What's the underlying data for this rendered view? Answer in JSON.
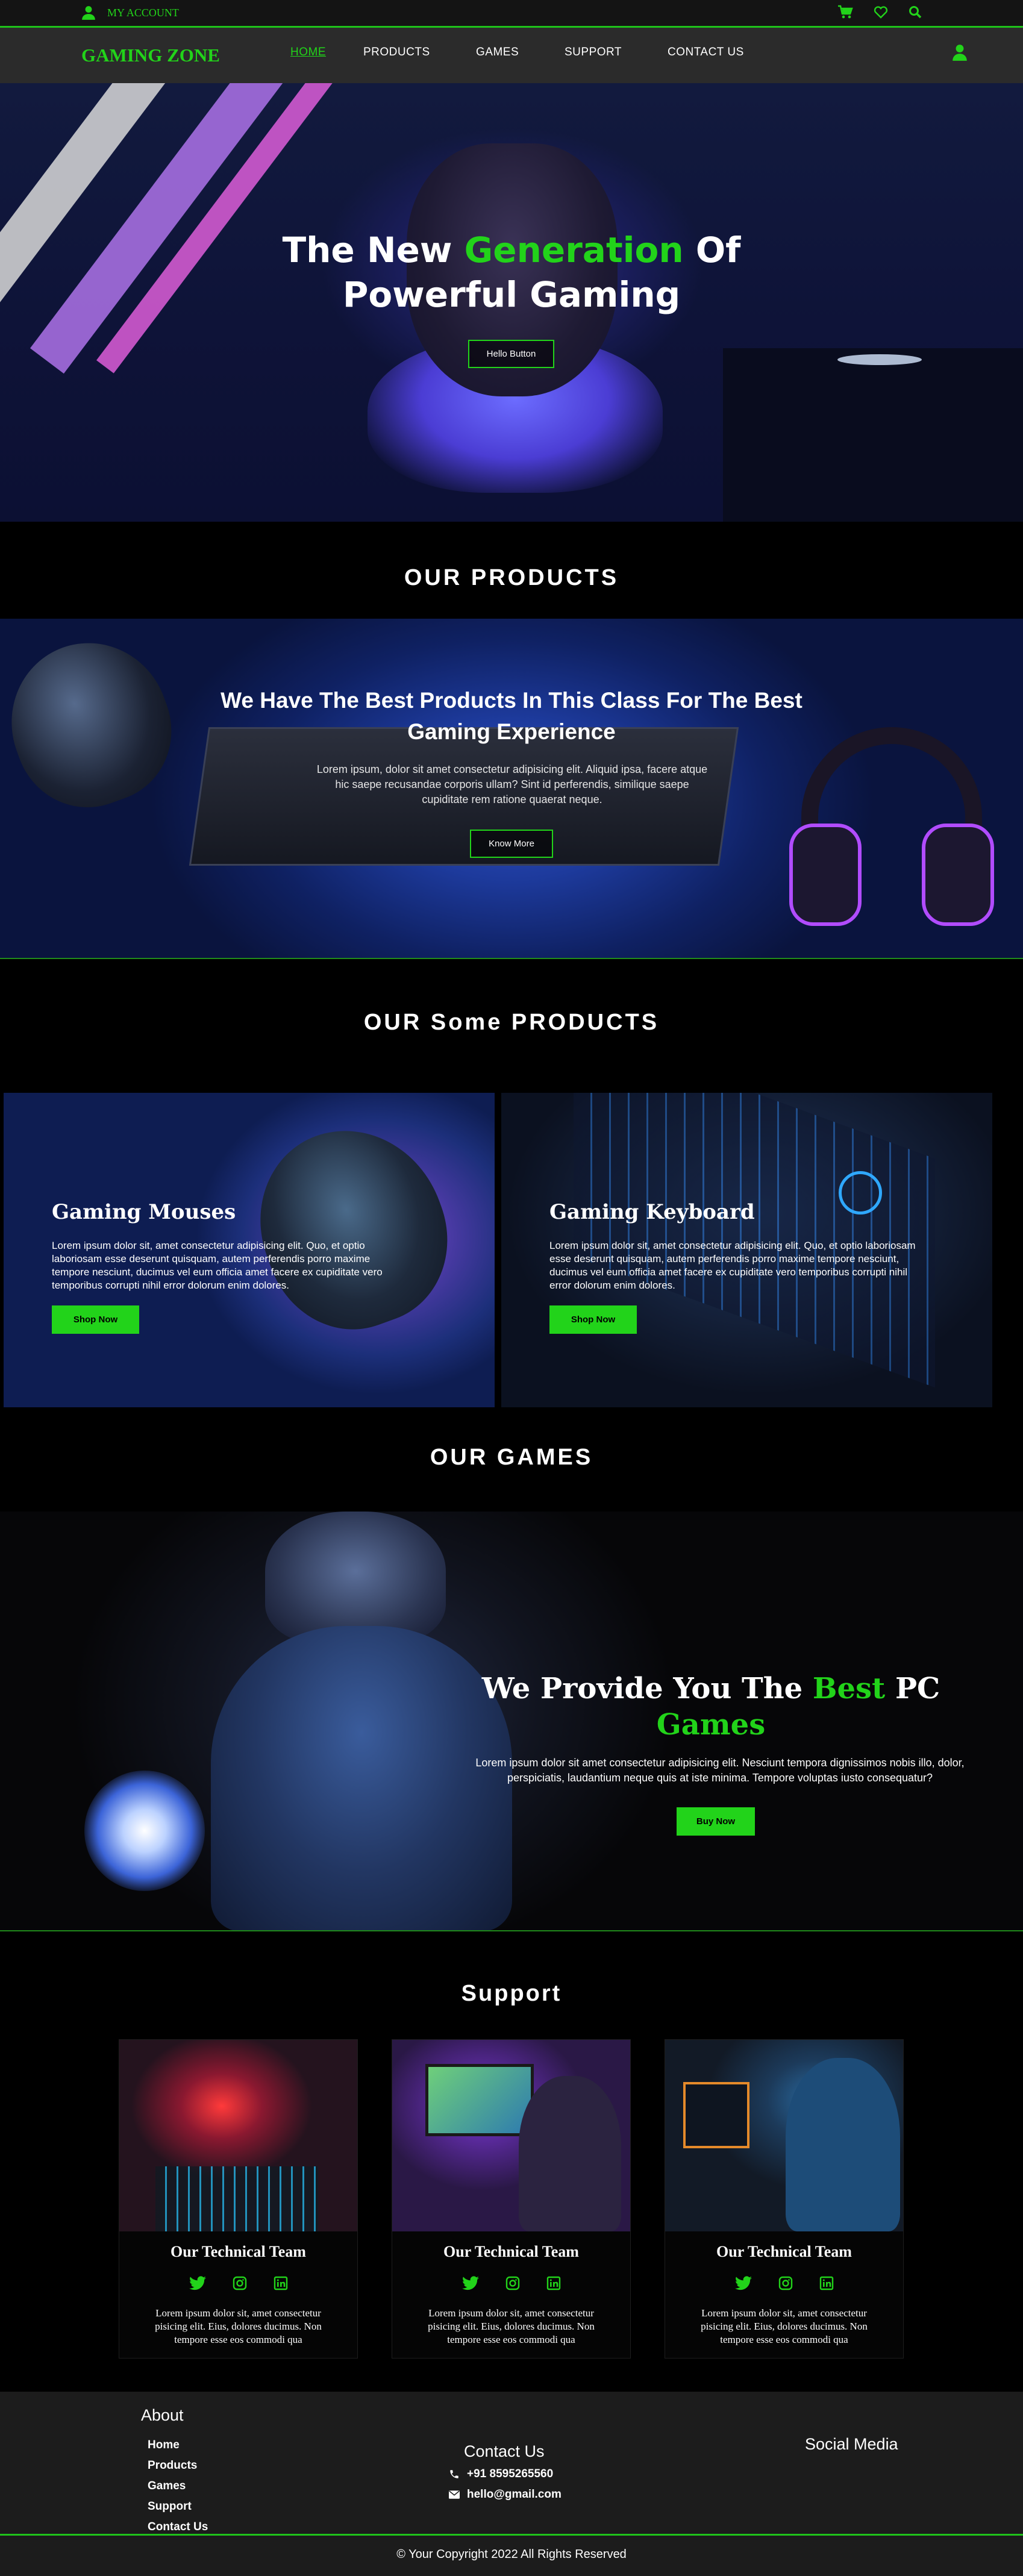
{
  "topbar": {
    "account_label": "MY ACCOUNT",
    "icons": [
      "user-icon",
      "cart-icon",
      "heart-icon",
      "search-icon"
    ]
  },
  "nav": {
    "logo": "GAMING ZONE",
    "links": [
      "HOME",
      "PRODUCTS",
      "GAMES",
      "SUPPORT",
      "CONTACT US"
    ],
    "active": "HOME"
  },
  "hero": {
    "title_line1_a": "The New ",
    "title_line1_b": "Generation",
    "title_line1_c": " Of",
    "title_line2": "Powerful Gaming",
    "button": "Hello Button"
  },
  "products": {
    "heading": "OUR PRODUCTS",
    "banner_title": "We Have The Best Products In This Class For The Best Gaming Experience",
    "banner_text": "Lorem ipsum, dolor sit amet consectetur adipisicing elit. Aliquid ipsa, facere atque hic saepe recusandae corporis ullam? Sint id perferendis, similique saepe cupiditate rem ratione quaerat neque.",
    "banner_button": "Know More"
  },
  "some_products": {
    "heading": "OUR Some PRODUCTS",
    "cards": [
      {
        "title": "Gaming Mouses",
        "text": "Lorem ipsum dolor sit, amet consectetur adipisicing elit. Quo, et optio laboriosam esse deserunt quisquam, autem perferendis porro maxime tempore nesciunt, ducimus vel eum officia amet facere ex cupiditate vero temporibus corrupti nihil error dolorum enim dolores.",
        "button": "Shop Now"
      },
      {
        "title": "Gaming Keyboard",
        "text": "Lorem ipsum dolor sit, amet consectetur adipisicing elit. Quo, et optio laboriosam esse deserunt quisquam, autem perferendis porro maxime tempore nesciunt, ducimus vel eum officia amet facere ex cupiditate vero temporibus corrupti nihil error dolorum enim dolores.",
        "button": "Shop Now"
      }
    ]
  },
  "games": {
    "heading": "OUR GAMES",
    "title_a": "We Provide You The ",
    "title_b": "Best",
    "title_c": " PC",
    "title_d": "Games",
    "text": "Lorem ipsum dolor sit amet consectetur adipisicing elit. Nesciunt tempora dignissimos nobis illo, dolor, perspiciatis, laudantium neque quis at iste minima. Tempore voluptas iusto consequatur?",
    "button": "Buy Now"
  },
  "support": {
    "heading": "Support",
    "cards": [
      {
        "title": "Our Technical Team",
        "text": "Lorem ipsum dolor sit, amet consectetur pisicing elit. Eius, dolores ducimus. Non tempore esse eos commodi qua"
      },
      {
        "title": "Our Technical Team",
        "text": "Lorem ipsum dolor sit, amet consectetur pisicing elit. Eius, dolores ducimus. Non tempore esse eos commodi qua"
      },
      {
        "title": "Our Technical Team",
        "text": "Lorem ipsum dolor sit, amet consectetur pisicing elit. Eius, dolores ducimus. Non tempore esse eos commodi qua"
      }
    ]
  },
  "footer": {
    "about_heading": "About",
    "about_links": [
      "Home",
      "Products",
      "Games",
      "Support",
      "Contact Us"
    ],
    "contact_heading": "Contact Us",
    "phone": "+91 8595265560",
    "email": "hello@gmail.com",
    "social_heading": "Social Media",
    "copyright": "© Your Copyright 2022 All Rights Reserved"
  },
  "colors": {
    "accent": "#22d31a",
    "nav_bg": "#2b2b2b",
    "footer_bg": "#1c1c1c"
  }
}
